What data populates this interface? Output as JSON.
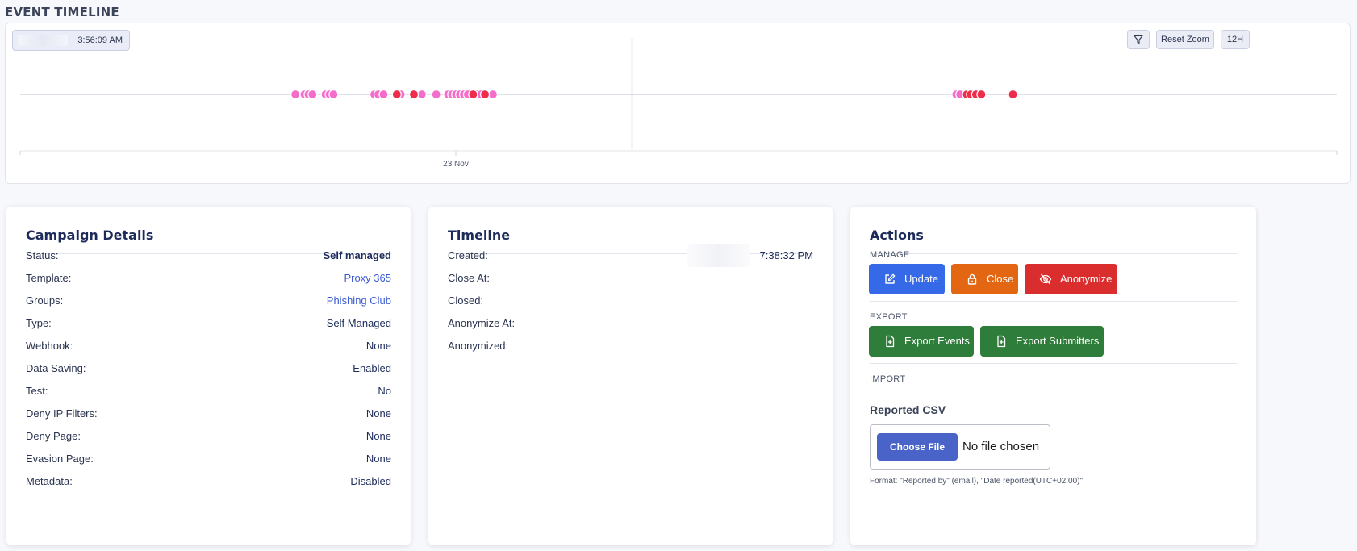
{
  "event_timeline": {
    "title": "EVENT TIMELINE",
    "time_display": "3:56:09 AM",
    "filter_icon": "filter-icon",
    "reset_zoom_label": "Reset Zoom",
    "range_label": "12H",
    "axis_tick_label": "23 Nov",
    "colors": {
      "pink": "#f56dcb",
      "red": "#ed2d49",
      "axis": "#d3d7df"
    },
    "events_pink_fraction": [
      0.209,
      0.216,
      0.219,
      0.222,
      0.232,
      0.235,
      0.238,
      0.269,
      0.272,
      0.276,
      0.289,
      0.305,
      0.316,
      0.325,
      0.328,
      0.331,
      0.334,
      0.337,
      0.34,
      0.344,
      0.347,
      0.35,
      0.359,
      0.711,
      0.714
    ],
    "events_red_fraction": [
      0.286,
      0.299,
      0.344,
      0.353,
      0.719,
      0.722,
      0.726,
      0.73,
      0.754
    ]
  },
  "campaign_details": {
    "title": "Campaign Details",
    "rows": [
      {
        "label": "Status:",
        "value": "Self managed",
        "style": "bold"
      },
      {
        "label": "Template:",
        "value": "Proxy 365",
        "style": "link"
      },
      {
        "label": "Groups:",
        "value": "Phishing Club",
        "style": "link"
      },
      {
        "label": "Type:",
        "value": "Self Managed",
        "style": "plain"
      },
      {
        "label": "Webhook:",
        "value": "None",
        "style": "plain"
      },
      {
        "label": "Data Saving:",
        "value": "Enabled",
        "style": "plain"
      },
      {
        "label": "Test:",
        "value": "No",
        "style": "plain"
      },
      {
        "label": "Deny IP Filters:",
        "value": "None",
        "style": "plain"
      },
      {
        "label": "Deny Page:",
        "value": "None",
        "style": "plain"
      },
      {
        "label": "Evasion Page:",
        "value": "None",
        "style": "plain"
      },
      {
        "label": "Metadata:",
        "value": "Disabled",
        "style": "plain"
      }
    ]
  },
  "timeline": {
    "title": "Timeline",
    "rows": [
      {
        "label": "Created:",
        "value": "7:38:32 PM"
      },
      {
        "label": "Close At:",
        "value": ""
      },
      {
        "label": "Closed:",
        "value": ""
      },
      {
        "label": "Anonymize At:",
        "value": ""
      },
      {
        "label": "Anonymized:",
        "value": ""
      }
    ]
  },
  "actions": {
    "title": "Actions",
    "manage_label": "MANAGE",
    "update_label": "Update",
    "close_label": "Close",
    "anonymize_label": "Anonymize",
    "export_label": "EXPORT",
    "export_events_label": "Export Events",
    "export_submitters_label": "Export Submitters",
    "import_label": "IMPORT",
    "reported_csv_label": "Reported CSV",
    "choose_file_label": "Choose File",
    "no_file_label": "No file chosen",
    "format_note": "Format: \"Reported by\" (email), \"Date reported(UTC+02:00)\"",
    "colors": {
      "update": "#3569e8",
      "close": "#e36613",
      "anonymize": "#da2e2e",
      "export": "#2f7d3a"
    }
  }
}
